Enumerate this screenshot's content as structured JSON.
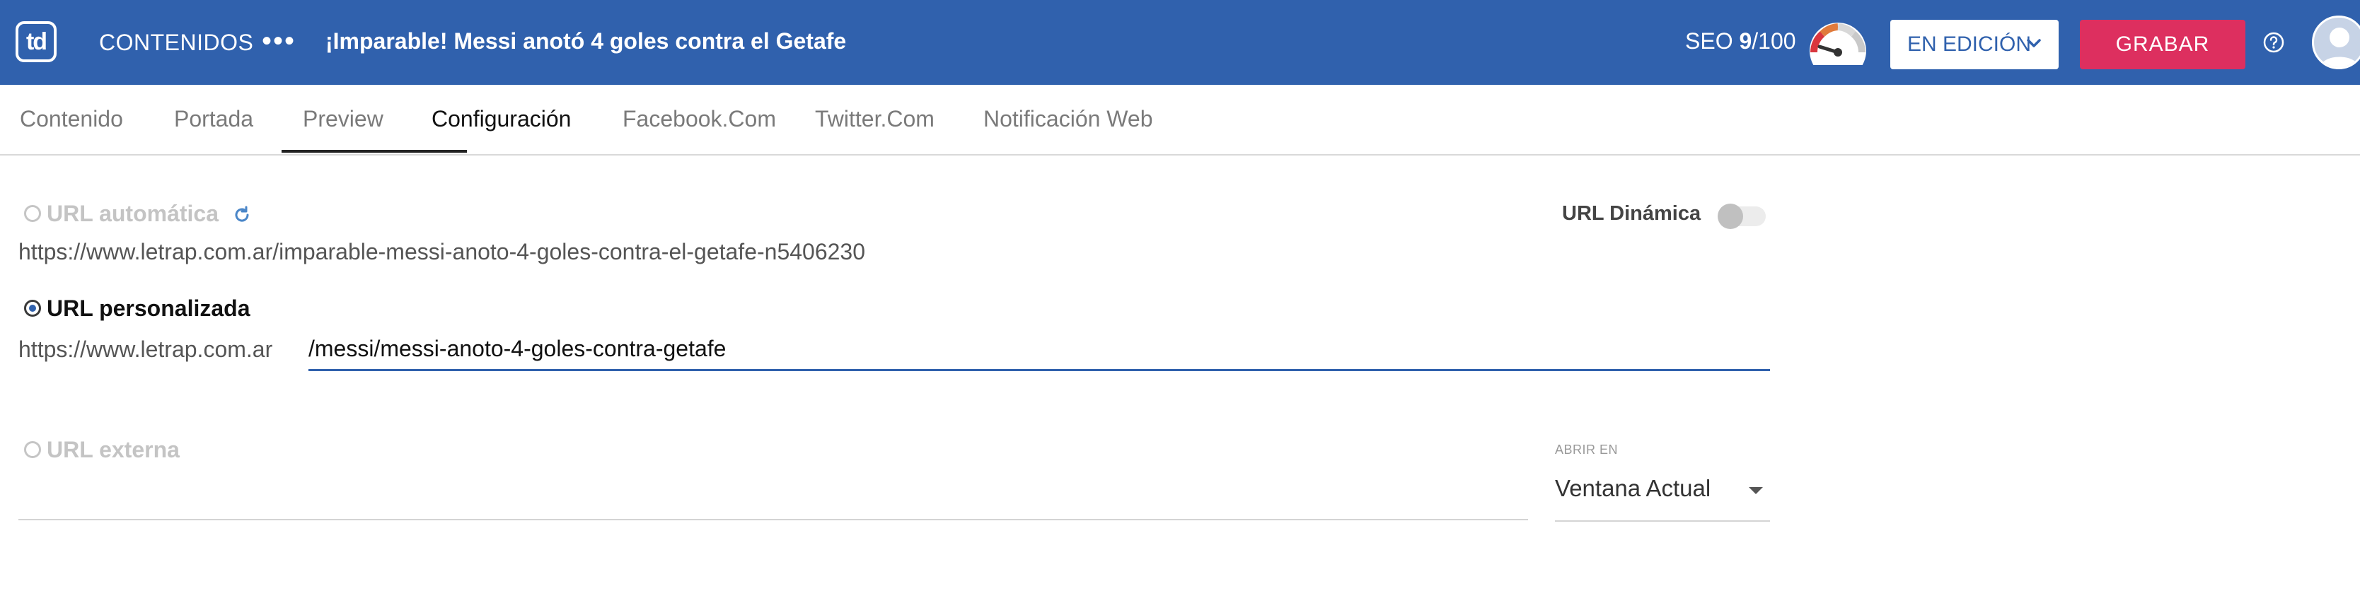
{
  "header": {
    "logo_text": "td",
    "section": "CONTENIDOS",
    "more": "•••",
    "article_title": "¡Imparable! Messi anotó 4 goles contra el Getafe",
    "seo_label": "SEO",
    "seo_score": "9",
    "seo_max": "/100",
    "status": "EN EDICIÓN",
    "save_label": "GRABAR",
    "colors": {
      "bar": "#3061ad",
      "save": "#dd2f5f"
    }
  },
  "tabs": [
    {
      "label": "Contenido"
    },
    {
      "label": "Portada"
    },
    {
      "label": "Preview"
    },
    {
      "label": "Configuración",
      "active": true
    },
    {
      "label": "Facebook.Com"
    },
    {
      "label": "Twitter.Com"
    },
    {
      "label": "Notificación Web"
    }
  ],
  "config": {
    "auto_url_label": "URL automática",
    "auto_url_value": "https://www.letrap.com.ar/imparable-messi-anoto-4-goles-contra-el-getafe-n5406230",
    "dynamic_url_label": "URL Dinámica",
    "dynamic_url_enabled": false,
    "custom_url_label": "URL personalizada",
    "custom_url_selected": true,
    "base_url": "https://www.letrap.com.ar",
    "custom_path": "/messi/messi-anoto-4-goles-contra-getafe",
    "external_url_label": "URL externa",
    "open_in_label": "ABRIR EN",
    "open_in_value": "Ventana Actual"
  }
}
